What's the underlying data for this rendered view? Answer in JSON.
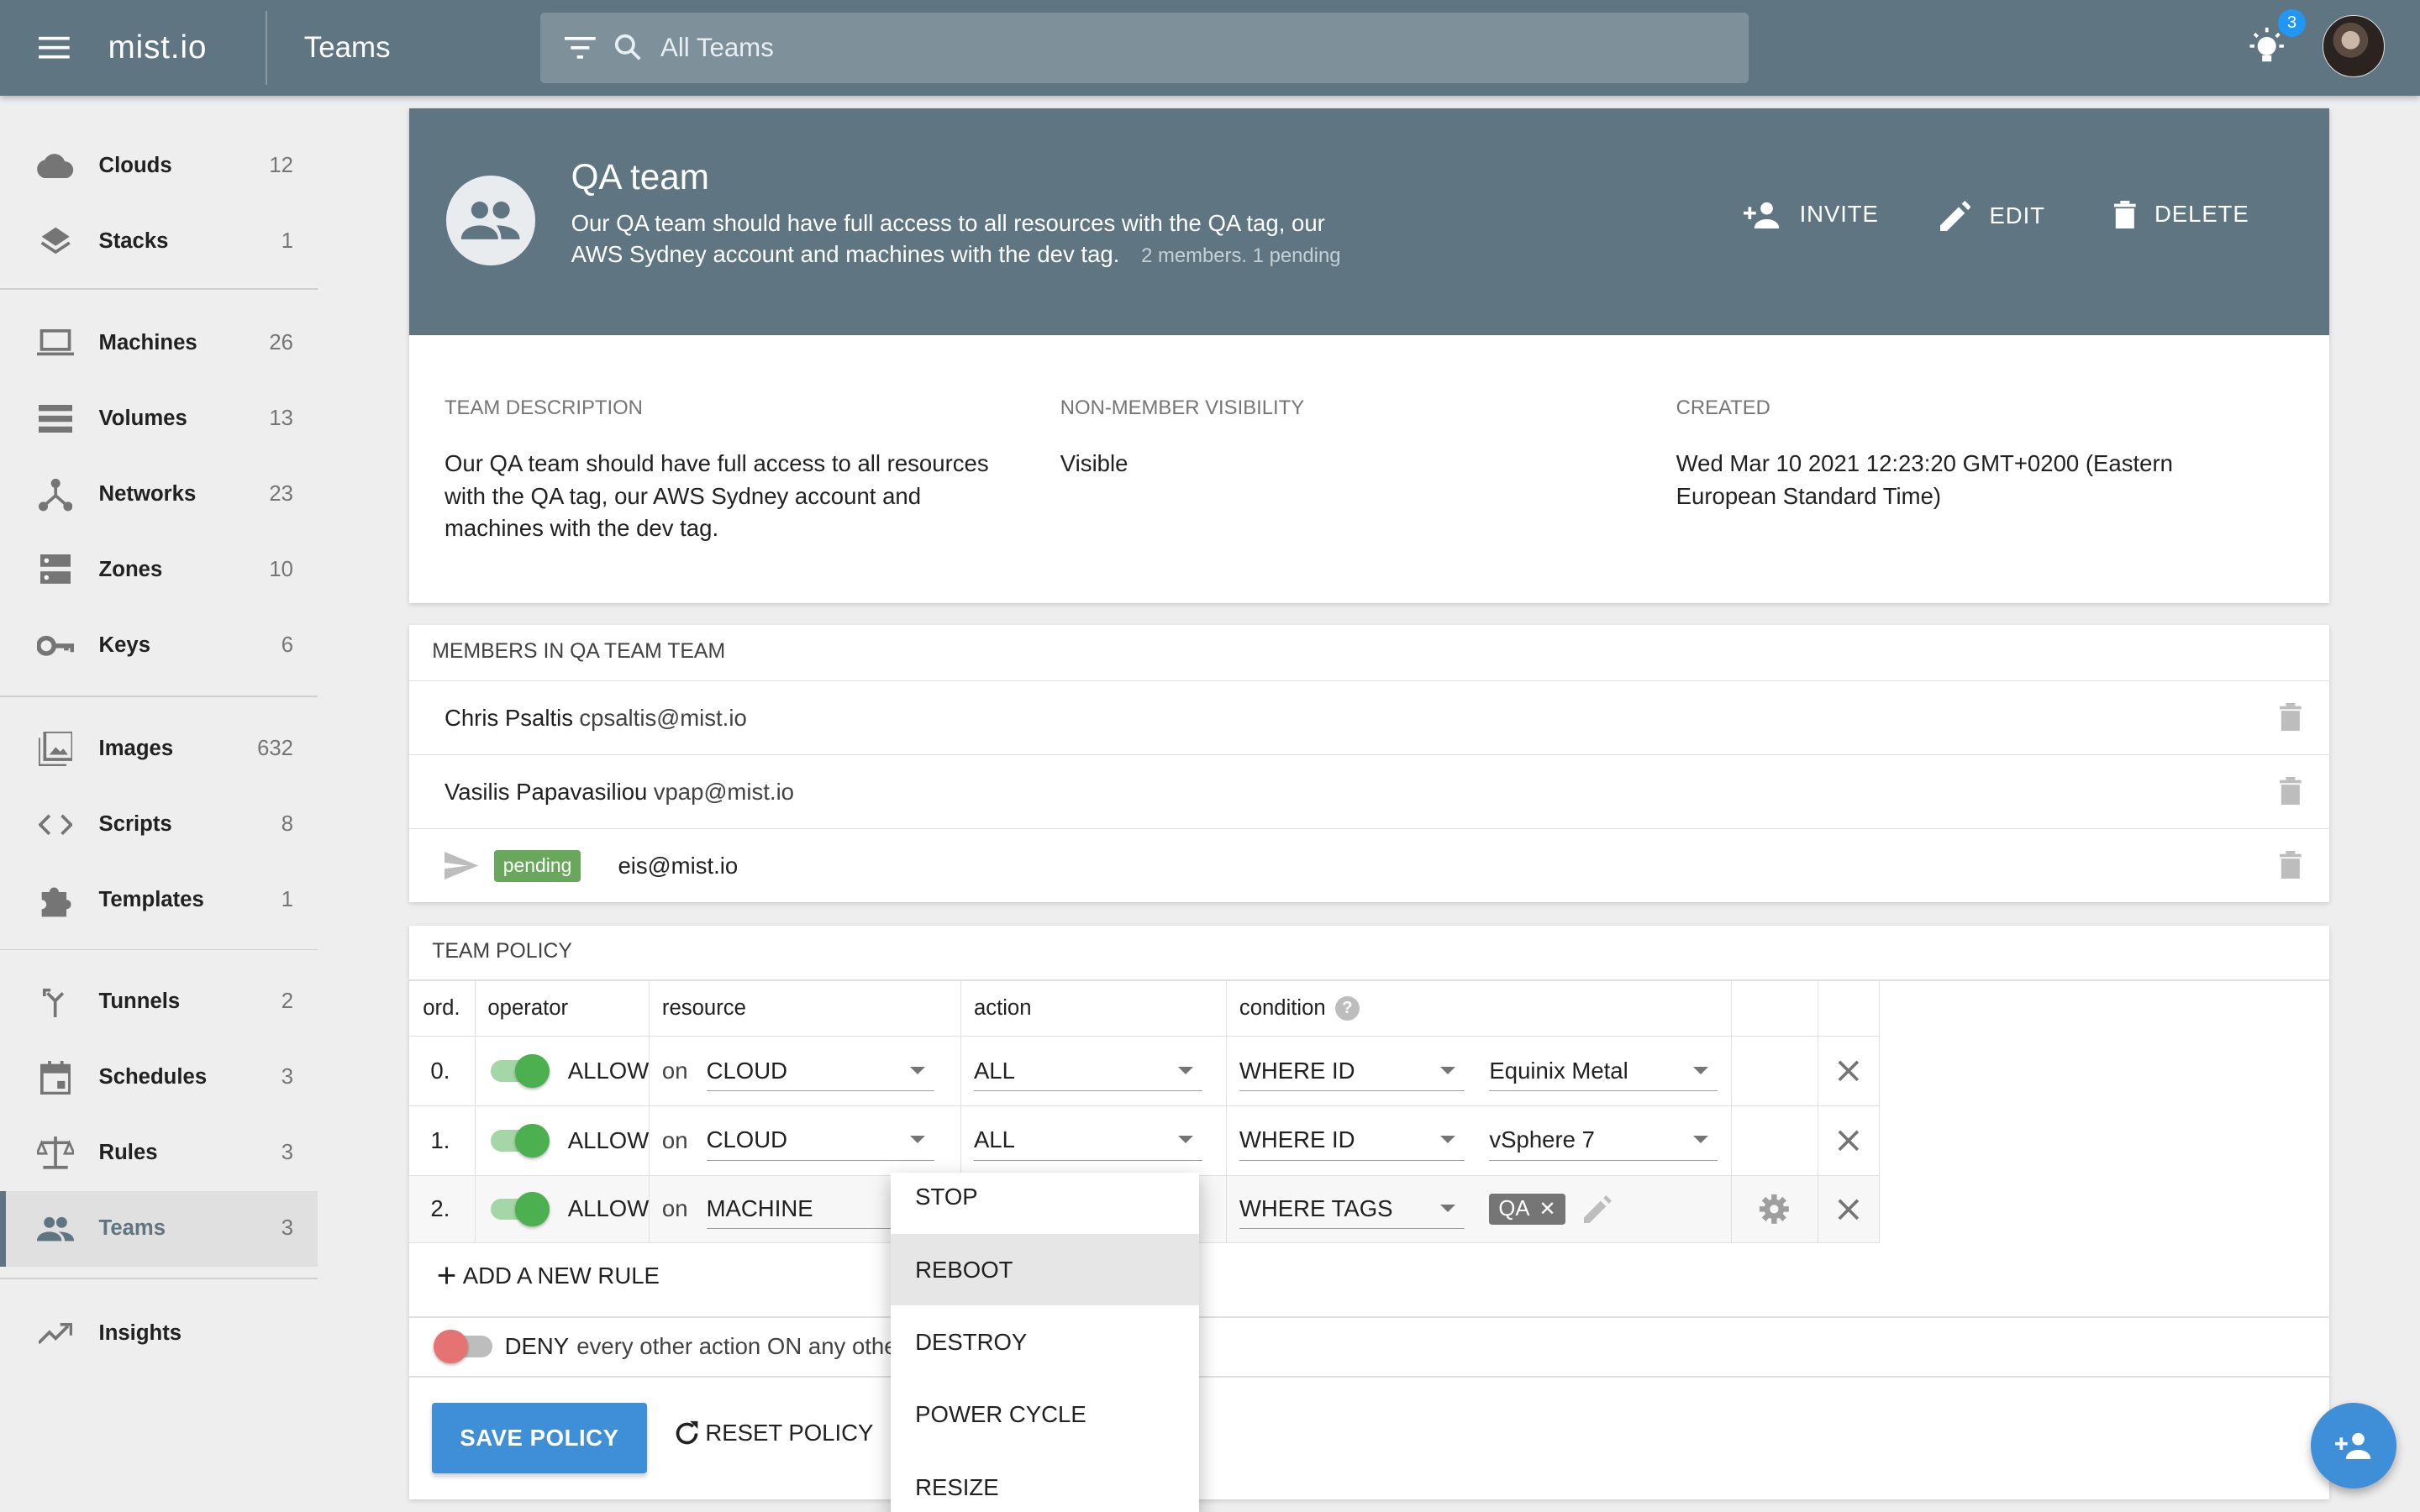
{
  "topbar": {
    "logo": "mist.io",
    "page_title": "Teams",
    "search_placeholder": "All Teams",
    "notification_count": "3"
  },
  "sidebar": {
    "items": [
      {
        "label": "Clouds",
        "count": "12",
        "icon": "cloud-icon"
      },
      {
        "label": "Stacks",
        "count": "1",
        "icon": "layers-icon"
      },
      {
        "label": "Machines",
        "count": "26",
        "icon": "laptop-icon"
      },
      {
        "label": "Volumes",
        "count": "13",
        "icon": "storage-icon"
      },
      {
        "label": "Networks",
        "count": "23",
        "icon": "network-icon"
      },
      {
        "label": "Zones",
        "count": "10",
        "icon": "dns-icon"
      },
      {
        "label": "Keys",
        "count": "6",
        "icon": "key-icon"
      },
      {
        "label": "Images",
        "count": "632",
        "icon": "image-icon"
      },
      {
        "label": "Scripts",
        "count": "8",
        "icon": "code-icon"
      },
      {
        "label": "Templates",
        "count": "1",
        "icon": "puzzle-icon"
      },
      {
        "label": "Tunnels",
        "count": "2",
        "icon": "merge-icon"
      },
      {
        "label": "Schedules",
        "count": "3",
        "icon": "calendar-icon"
      },
      {
        "label": "Rules",
        "count": "3",
        "icon": "scale-icon"
      },
      {
        "label": "Teams",
        "count": "3",
        "icon": "people-icon"
      },
      {
        "label": "Insights",
        "count": "",
        "icon": "trending-icon"
      }
    ]
  },
  "team": {
    "name": "QA team",
    "description": "Our QA team should have full access to all resources with the QA tag, our AWS Sydney account and machines with the dev tag.",
    "members_summary": "2 members. 1 pending",
    "actions": {
      "invite": "INVITE",
      "edit": "EDIT",
      "delete": "DELETE"
    }
  },
  "info": {
    "description_label": "TEAM DESCRIPTION",
    "description_value": "Our QA team should have full access to all resources with the QA tag, our AWS Sydney account and machines with the dev tag.",
    "visibility_label": "NON-MEMBER VISIBILITY",
    "visibility_value": "Visible",
    "created_label": "CREATED",
    "created_value": "Wed Mar 10 2021 12:23:20 GMT+0200 (Eastern European Standard Time)"
  },
  "members": {
    "title": "MEMBERS IN QA TEAM TEAM",
    "rows": [
      {
        "name": "Chris Psaltis",
        "email": "cpsaltis@mist.io"
      },
      {
        "name": "Vasilis Papavasiliou",
        "email": "vpap@mist.io"
      },
      {
        "name": "",
        "email": "eis@mist.io",
        "status": "pending"
      }
    ]
  },
  "policy": {
    "title": "TEAM POLICY",
    "headers": {
      "ord": "ord.",
      "operator": "operator",
      "resource": "resource",
      "action": "action",
      "condition": "condition"
    },
    "rules": [
      {
        "ord": "0.",
        "operator": "ALLOW",
        "on": "on",
        "resource": "CLOUD",
        "action": "ALL",
        "condition": "WHERE ID",
        "value": "Equinix Metal"
      },
      {
        "ord": "1.",
        "operator": "ALLOW",
        "on": "on",
        "resource": "CLOUD",
        "action": "ALL",
        "condition": "WHERE ID",
        "value": "vSphere 7"
      },
      {
        "ord": "2.",
        "operator": "ALLOW",
        "on": "on",
        "resource": "MACHINE",
        "action": "",
        "condition": "WHERE TAGS",
        "value": "QA"
      }
    ],
    "add_rule": "ADD A NEW RULE",
    "deny_bold": "DENY",
    "deny_text": "every other action ON any othe",
    "save": "SAVE POLICY",
    "reset": "RESET POLICY"
  },
  "dropdown": {
    "options": [
      "STOP",
      "REBOOT",
      "DESTROY",
      "POWER CYCLE",
      "RESIZE"
    ],
    "highlighted": "REBOOT"
  },
  "colors": {
    "topbar": "#5f7682",
    "accent": "#3f8ed8",
    "allow": "#4caf50",
    "deny": "#e57373",
    "pending": "#69a85c"
  }
}
